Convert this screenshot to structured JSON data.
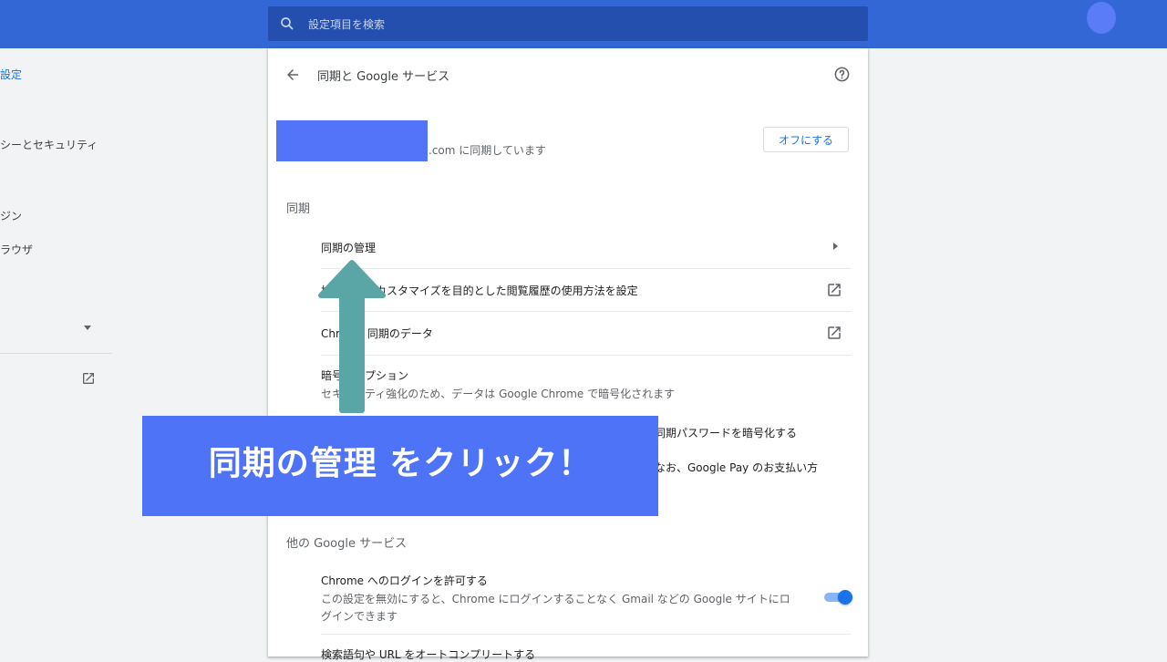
{
  "search": {
    "placeholder": "設定項目を検索"
  },
  "nav": {
    "items": [
      {
        "label": "設定"
      },
      {
        "label": "シーとセキュリティ"
      },
      {
        "label": "ジン"
      },
      {
        "label": "ラウザ"
      }
    ]
  },
  "page": {
    "title": "同期と Google サービス"
  },
  "account": {
    "sync_text": ".com に同期しています",
    "off_button": "オフにする"
  },
  "sync_section": {
    "heading": "同期",
    "manage_sync": "同期の管理",
    "history_usage": "検索などのカスタマイズを目的とした閲覧履歴の使用方法を設定",
    "chrome_data": "Chrome 同期のデータ",
    "encryption_title": "暗号化オプション",
    "encryption_desc": "セキュリティ強化のため、データは Google Chrome で暗号化されます",
    "encrypt_passwords": "同期パスワードを暗号化する",
    "google_pay_note": "なお、Google Pay のお支払い方"
  },
  "other_section": {
    "heading": "他の Google サービス",
    "allow_login_title": "Chrome へのログインを許可する",
    "allow_login_desc_line1": "この設定を無効にすると、Chrome にログインすることなく Gmail などの Google サイトにロ",
    "allow_login_desc_line2": "グインできます",
    "allow_login_enabled": true,
    "autocomplete": "検索語句や URL をオートコンプリートする"
  },
  "annotation": {
    "banner_text": "同期の管理 をクリック！"
  },
  "colors": {
    "topbar": "#3367d6",
    "accent": "#1a73e8",
    "banner": "#4f73f6",
    "arrow": "#5aa6a6"
  }
}
